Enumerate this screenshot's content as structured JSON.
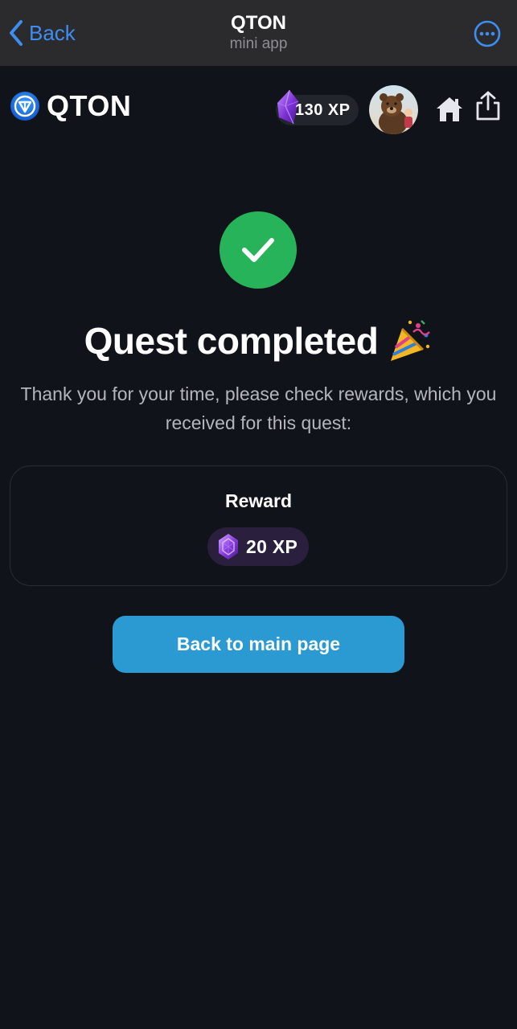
{
  "tg_bar": {
    "back_label": "Back",
    "title": "QTON",
    "subtitle": "mini app"
  },
  "header": {
    "logo_text": "QTON",
    "xp_balance": "130 XP"
  },
  "main": {
    "headline": "Quest completed",
    "subtext": "Thank you for your time, please check rewards, which you received for this quest:",
    "reward": {
      "title": "Reward",
      "amount": "20 XP"
    },
    "button_label": "Back to main page"
  },
  "icons": {
    "back": "chevron-left-icon",
    "more": "ellipsis-circle-icon",
    "logo": "qton-logo-icon",
    "gem": "purple-gem-icon",
    "home": "home-icon",
    "share": "share-icon",
    "check": "checkmark-icon",
    "party": "party-popper-icon"
  },
  "colors": {
    "background": "#11131a",
    "telegram_bar": "#2b2b2d",
    "link_blue": "#3e8df0",
    "success_green": "#27b35a",
    "primary_button": "#2b9ad2",
    "reward_pill": "#2a1f3c",
    "gem_purple": "#8a3fe0"
  }
}
